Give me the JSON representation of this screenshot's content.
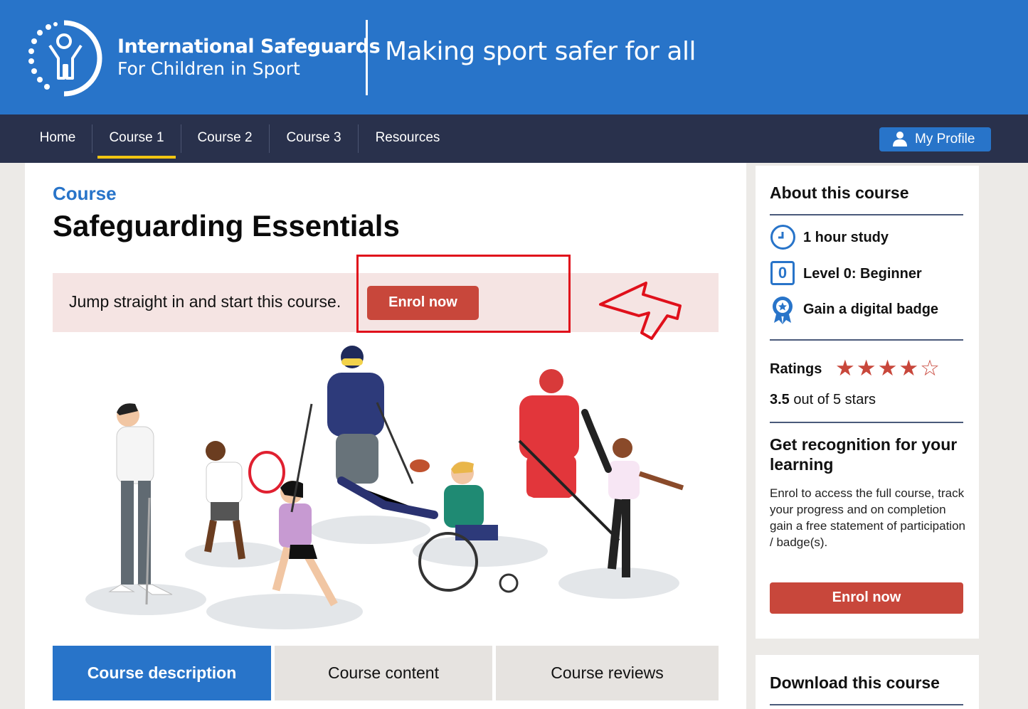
{
  "header": {
    "org_name_line1": "International Safeguards",
    "org_name_line2": "For Children in Sport",
    "tagline": "Making sport safer for all",
    "brand_color": "#2874c9"
  },
  "nav": {
    "items": [
      {
        "label": "Home"
      },
      {
        "label": "Course 1",
        "active": true
      },
      {
        "label": "Course 2"
      },
      {
        "label": "Course 3"
      },
      {
        "label": "Resources"
      }
    ],
    "profile_label": "My Profile",
    "active_indicator_color": "#f2c511",
    "background_color": "#29314c"
  },
  "main": {
    "eyebrow": "Course",
    "title": "Safeguarding Essentials",
    "banner_text": "Jump straight in and start this course.",
    "enrol_label": "Enrol now",
    "highlight_color": "#e0101b",
    "tabs": [
      {
        "label": "Course description",
        "active": true
      },
      {
        "label": "Course content"
      },
      {
        "label": "Course reviews"
      }
    ]
  },
  "sidebar": {
    "about_heading": "About this course",
    "meta": [
      {
        "icon": "clock-icon",
        "label": "1 hour study"
      },
      {
        "icon": "level-icon",
        "icon_text": "0",
        "label": "Level 0: Beginner"
      },
      {
        "icon": "badge-icon",
        "label": "Gain a digital badge"
      }
    ],
    "ratings_label": "Ratings",
    "rating_value": "3.5",
    "rating_suffix": " out of 5 stars",
    "stars_display": "★★★★☆",
    "recognition_heading": "Get recognition for your learning",
    "recognition_text": "Enrol to access the full course, track your progress and on completion gain a free statement of participation / badge(s).",
    "enrol_label": "Enrol now",
    "download_heading": "Download this course",
    "accent_color": "#c8473b"
  }
}
